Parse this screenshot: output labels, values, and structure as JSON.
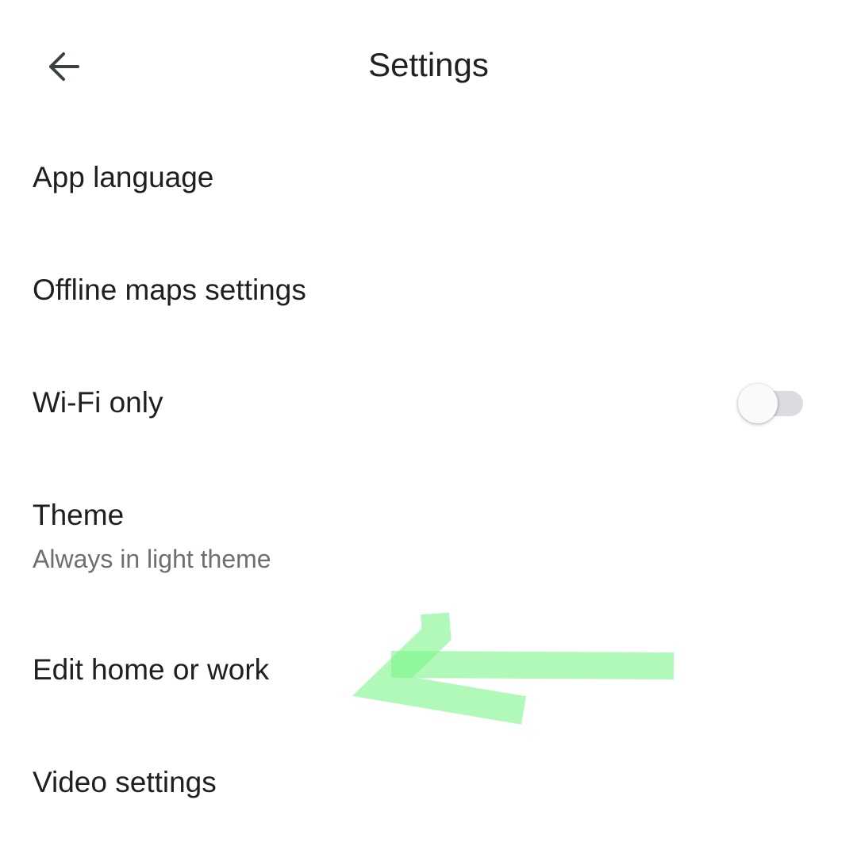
{
  "header": {
    "title": "Settings",
    "back_icon": "arrow-back-icon"
  },
  "settings": {
    "items": [
      {
        "label": "App language"
      },
      {
        "label": "Offline maps settings"
      },
      {
        "label": "Wi-Fi only",
        "toggle_on": false
      },
      {
        "label": "Theme",
        "subtitle": "Always in light theme"
      },
      {
        "label": "Edit home or work"
      },
      {
        "label": "Video settings"
      }
    ]
  },
  "colors": {
    "annotation_arrow": "#7cf58a",
    "toggle_track_off": "#dadce0",
    "subtitle_text": "#6f6f6f"
  }
}
